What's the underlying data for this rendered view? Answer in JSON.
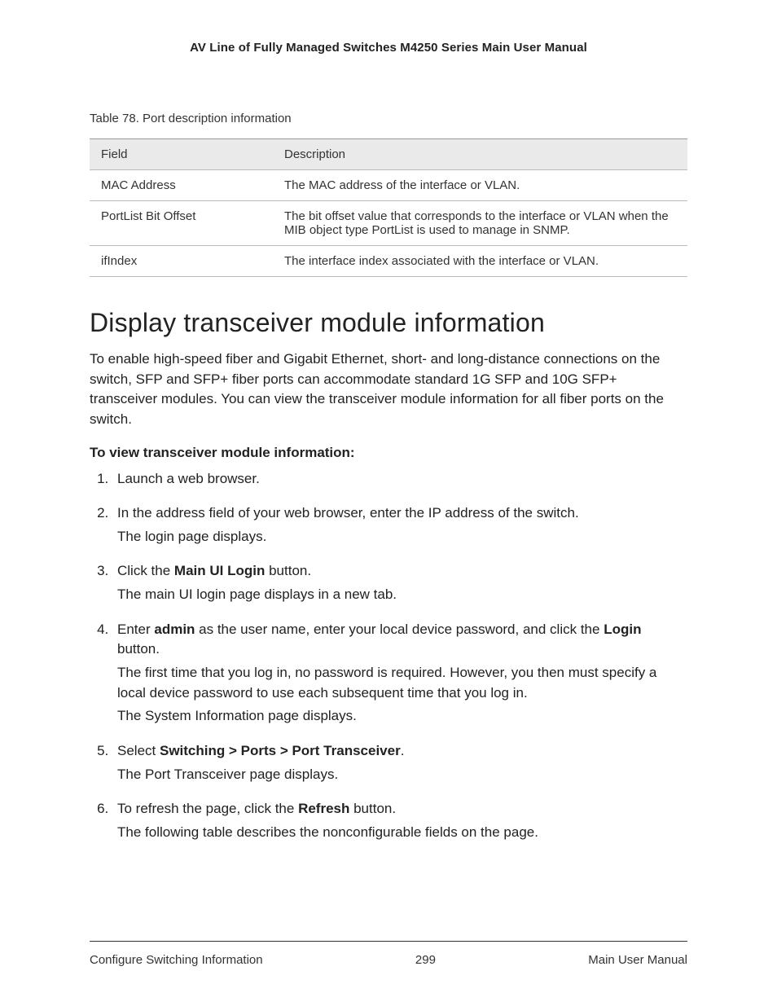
{
  "header": {
    "title": "AV Line of Fully Managed Switches M4250 Series Main User Manual"
  },
  "table": {
    "caption": "Table 78. Port description information",
    "columns": [
      "Field",
      "Description"
    ],
    "rows": [
      {
        "field": "MAC Address",
        "desc": "The MAC address of the interface or VLAN."
      },
      {
        "field": "PortList Bit Offset",
        "desc": "The bit offset value that corresponds to the interface or VLAN when the MIB object type PortList is used to manage in SNMP."
      },
      {
        "field": "ifIndex",
        "desc": "The interface index associated with the interface or VLAN."
      }
    ]
  },
  "section": {
    "heading": "Display transceiver module information",
    "intro": "To enable high-speed fiber and Gigabit Ethernet, short- and long-distance connections on the switch, SFP and SFP+ fiber ports can accommodate standard 1G SFP and 10G SFP+ transceiver modules. You can view the transceiver module information for all fiber ports on the switch.",
    "subhead": "To view transceiver module information:",
    "steps": {
      "s1": "Launch a web browser.",
      "s2a": "In the address field of your web browser, enter the IP address of the switch.",
      "s2b": "The login page displays.",
      "s3a_pre": "Click the ",
      "s3a_bold": "Main UI Login",
      "s3a_post": " button.",
      "s3b": "The main UI login page displays in a new tab.",
      "s4a_pre": "Enter ",
      "s4a_bold1": "admin",
      "s4a_mid": " as the user name, enter your local device password, and click the ",
      "s4a_bold2": "Login",
      "s4a_post": " button.",
      "s4b": "The first time that you log in, no password is required. However, you then must specify a local device password to use each subsequent time that you log in.",
      "s4c": "The System Information page displays.",
      "s5a_pre": "Select ",
      "s5a_bold": "Switching > Ports > Port Transceiver",
      "s5a_post": ".",
      "s5b": "The Port Transceiver page displays.",
      "s6a_pre": "To refresh the page, click the ",
      "s6a_bold": "Refresh",
      "s6a_post": " button.",
      "s6b": "The following table describes the nonconfigurable fields on the page."
    }
  },
  "footer": {
    "left": "Configure Switching Information",
    "center": "299",
    "right": "Main User Manual"
  }
}
